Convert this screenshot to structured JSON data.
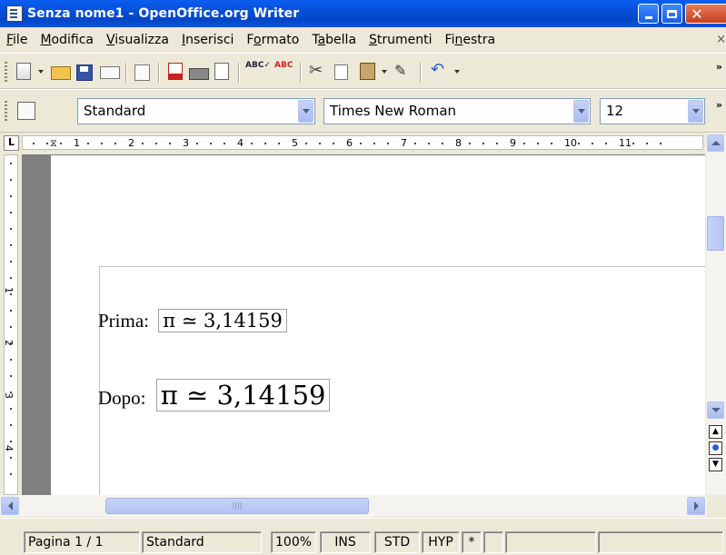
{
  "window": {
    "title": "Senza nome1 - OpenOffice.org Writer"
  },
  "menu": {
    "items": [
      {
        "label": "File",
        "key": "F"
      },
      {
        "label": "Modifica",
        "key": "M"
      },
      {
        "label": "Visualizza",
        "key": "V"
      },
      {
        "label": "Inserisci",
        "key": "I"
      },
      {
        "label": "Formato",
        "key": "o"
      },
      {
        "label": "Tabella",
        "key": "a"
      },
      {
        "label": "Strumenti",
        "key": "S"
      },
      {
        "label": "Finestra",
        "key": "n"
      }
    ],
    "close_glyph": "×"
  },
  "toolbar": {
    "icons": [
      "new-document-icon",
      "open-folder-icon",
      "save-icon",
      "email-icon",
      "edit-document-icon",
      "export-pdf-icon",
      "print-icon",
      "page-preview-icon",
      "spellcheck-icon",
      "autospellcheck-icon",
      "cut-icon",
      "copy-icon",
      "paste-icon",
      "format-paintbrush-icon",
      "undo-icon"
    ],
    "overflow": "»"
  },
  "formatting": {
    "style": "Standard",
    "font": "Times New Roman",
    "size": "12",
    "overflow": "»"
  },
  "ruler": {
    "corner": "L",
    "numbers": [
      "1",
      "2",
      "3",
      "4",
      "5",
      "6",
      "7",
      "8",
      "9",
      "10",
      "11"
    ],
    "v_numbers": [
      "1",
      "2",
      "3",
      "4"
    ]
  },
  "document": {
    "line1_label": "Prima:",
    "line1_formula": "π ≃ 3,14159",
    "line2_label": "Dopo:",
    "line2_formula": "π ≃ 3,14159"
  },
  "status": {
    "page": "Pagina 1 / 1",
    "style": "Standard",
    "zoom": "100%",
    "insert_mode": "INS",
    "selection_mode": "STD",
    "hyperlink_mode": "HYP",
    "modified": "*"
  },
  "colors": {
    "titlebar": "#0550d8",
    "chrome": "#ece9d8",
    "page": "#ffffff",
    "workspace": "#808080"
  }
}
